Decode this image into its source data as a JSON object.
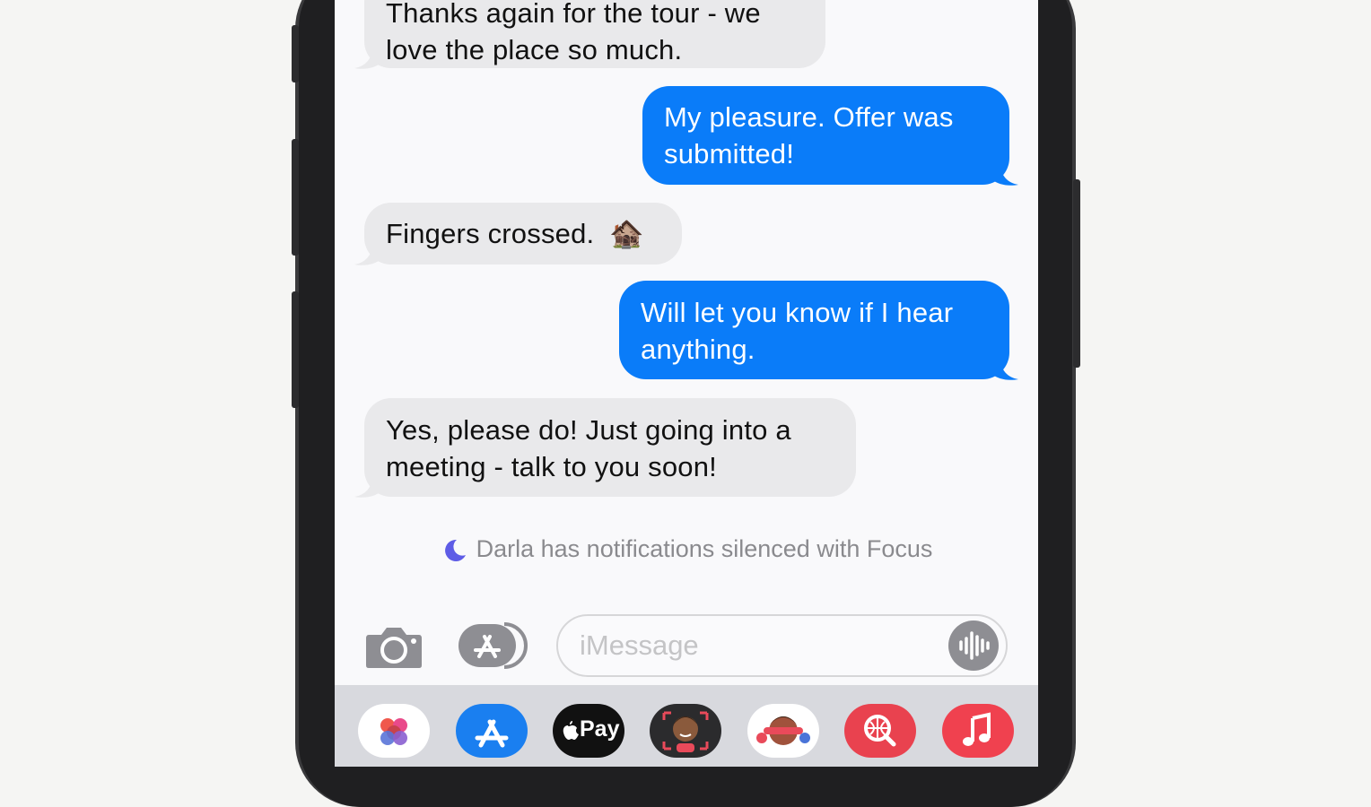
{
  "conversation": {
    "messages": [
      {
        "from": "received",
        "text_line1": "Thanks again for the tour - we",
        "text_line2": "love the place so much."
      },
      {
        "from": "sent",
        "text_line1": "My pleasure. Offer was",
        "text_line2": "submitted!"
      },
      {
        "from": "received",
        "text": "Fingers crossed.",
        "emoji": "🏚️"
      },
      {
        "from": "sent",
        "text_line1": "Will let you know if I hear",
        "text_line2": "anything."
      },
      {
        "from": "received",
        "text_line1": "Yes, please do! Just going into a",
        "text_line2": "meeting - talk to you soon!"
      }
    ],
    "focus_notice": "Darla has notifications silenced with Focus"
  },
  "composer": {
    "placeholder": "iMessage",
    "camera_icon": "camera-icon",
    "apps_icon": "app-store-icon",
    "audio_icon": "waveform-icon"
  },
  "app_drawer": {
    "apps": [
      {
        "name": "photos-icon"
      },
      {
        "name": "app-store-icon"
      },
      {
        "name": "apple-pay-icon",
        "label": "Pay"
      },
      {
        "name": "memoji-icon"
      },
      {
        "name": "memoji-stickers-icon"
      },
      {
        "name": "images-search-icon"
      },
      {
        "name": "music-icon"
      }
    ]
  },
  "colors": {
    "sent_bubble": "#0a7cf9",
    "received_bubble": "#e9e9eb",
    "apple_pay": "#111111",
    "app_store": "#1a7ff0",
    "search": "#e9424f",
    "music": "#f0414f"
  }
}
